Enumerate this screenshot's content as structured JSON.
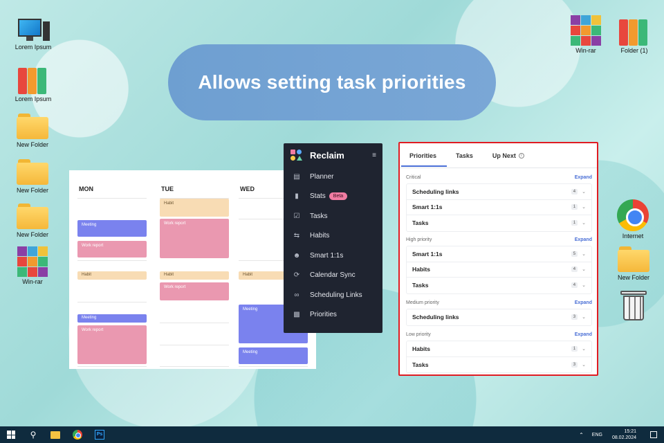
{
  "banner": {
    "title": "Allows setting task priorities"
  },
  "desktop_left": [
    {
      "label": "Lorem Ipsum",
      "icon": "computer-icon"
    },
    {
      "label": "Lorem Ipsum",
      "icon": "binders-icon"
    },
    {
      "label": "New Folder",
      "icon": "folder-icon"
    },
    {
      "label": "New Folder",
      "icon": "folder-icon"
    },
    {
      "label": "New Folder",
      "icon": "folder-icon"
    },
    {
      "label": "Win-rar",
      "icon": "winrar-icon"
    }
  ],
  "desktop_right": [
    {
      "label": "Win-rar",
      "icon": "winrar-icon"
    },
    {
      "label": "Folder (1)",
      "icon": "binders-icon"
    },
    {
      "label": "Internet",
      "icon": "chrome-icon"
    },
    {
      "label": "New Folder",
      "icon": "folder-icon"
    }
  ],
  "calendar": {
    "days": [
      "MON",
      "TUE",
      "WED"
    ],
    "events": {
      "habit": "Habit",
      "meeting": "Meeting",
      "work_report": "Work report"
    }
  },
  "sidebar": {
    "brand": "Reclaim",
    "items": [
      {
        "label": "Planner",
        "icon": "calendar-icon"
      },
      {
        "label": "Stats",
        "icon": "bar-chart-icon",
        "badge": "Beta"
      },
      {
        "label": "Tasks",
        "icon": "checkbox-icon"
      },
      {
        "label": "Habits",
        "icon": "repeat-icon"
      },
      {
        "label": "Smart 1:1s",
        "icon": "people-icon"
      },
      {
        "label": "Calendar Sync",
        "icon": "sync-icon"
      },
      {
        "label": "Scheduling Links",
        "icon": "link-icon"
      },
      {
        "label": "Priorities",
        "icon": "signal-icon"
      }
    ]
  },
  "priorities_panel": {
    "tabs": [
      "Priorities",
      "Tasks",
      "Up Next"
    ],
    "expand_label": "Expand",
    "groups": [
      {
        "title": "Critical",
        "rows": [
          {
            "label": "Scheduling links",
            "count": "4"
          },
          {
            "label": "Smart 1:1s",
            "count": "1"
          },
          {
            "label": "Tasks",
            "count": "1"
          }
        ]
      },
      {
        "title": "High priority",
        "rows": [
          {
            "label": "Smart 1:1s",
            "count": "5"
          },
          {
            "label": "Habits",
            "count": "4"
          },
          {
            "label": "Tasks",
            "count": "4"
          }
        ]
      },
      {
        "title": "Medium priority",
        "rows": [
          {
            "label": "Scheduling links",
            "count": "3"
          }
        ]
      },
      {
        "title": "Low priority",
        "rows": [
          {
            "label": "Habits",
            "count": "1"
          },
          {
            "label": "Tasks",
            "count": "3"
          }
        ]
      }
    ]
  },
  "taskbar": {
    "language": "ENG",
    "time": "15:21",
    "date": "08.02.2024"
  }
}
